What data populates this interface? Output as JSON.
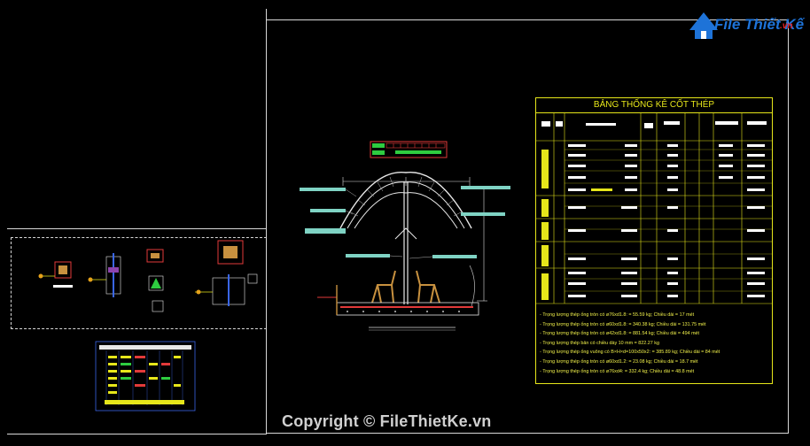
{
  "header": {
    "logo_text": "File Thiết Kế",
    "logo_suffix": ".vn",
    "logo_icon": "house-icon"
  },
  "table": {
    "title": "BẢNG THỐNG KÊ CỐT THÉP"
  },
  "notes": [
    "- Trọng lượng thép ống tròn có ø76xd1.8:  = 55.59 kg; Chiều dài = 17 mét",
    "- Trọng lượng thép ống tròn có ø60xd1.8:  = 340.38 kg; Chiều dài = 131.75 mét",
    "- Trọng lượng thép ống tròn có ø42xd1.8:  = 881.54 kg; Chiều dài = 494 mét",
    "- Trọng lượng thép bản có chiều dày   10 mm  = 822.27 kg",
    "- Trọng lượng thép ống vuông có B×H×d=100x50x2:  = 385.89 kg; Chiều dài = 84 mét",
    "- Trọng lượng thép ống tròn có ø60xd1.2:  = 23.08 kg; Chiều dài = 18.7 mét",
    "- Trọng lượng thép ống tròn có ø76xd4:  = 332.4 kg; Chiều dài = 48.8 mét"
  ],
  "footer": {
    "copyright": "Copyright © FileThietKe.vn"
  },
  "colors": {
    "background": "#000000",
    "frame": "#d8d8d8",
    "table_line": "#e6e61a",
    "cyan": "#7fd3c4",
    "red": "#e23a3a",
    "green": "#2ecc40"
  }
}
